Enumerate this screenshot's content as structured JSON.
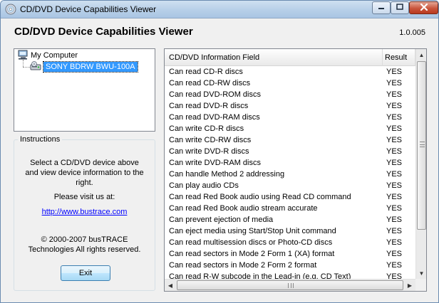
{
  "window": {
    "title": "CD/DVD Device Capabilities Viewer",
    "accent_color": "#b7cfe8",
    "close_color": "#c9553c"
  },
  "header": {
    "title": "CD/DVD Device Capabilities Viewer",
    "version": "1.0.005"
  },
  "tree": {
    "root_label": "My Computer",
    "root_icon": "computer-icon",
    "device_label": "SONY BDRW BWU-100A",
    "device_icon": "cd-drive-icon",
    "selection_color": "#3399ff"
  },
  "instructions": {
    "group_label": "Instructions",
    "text_1": "Select a CD/DVD device above and view device information to the right.",
    "text_2": "Please visit us at:",
    "link": "http://www.bustrace.com",
    "copyright": "© 2000-2007 busTRACE Technologies All rights reserved.",
    "exit_label": "Exit"
  },
  "list": {
    "columns": [
      "CD/DVD Information Field",
      "Result"
    ],
    "rows": [
      [
        "Can read CD-R discs",
        "YES"
      ],
      [
        "Can read CD-RW discs",
        "YES"
      ],
      [
        "Can read DVD-ROM discs",
        "YES"
      ],
      [
        "Can read DVD-R discs",
        "YES"
      ],
      [
        "Can read DVD-RAM discs",
        "YES"
      ],
      [
        "Can write CD-R discs",
        "YES"
      ],
      [
        "Can write CD-RW discs",
        "YES"
      ],
      [
        "Can write DVD-R discs",
        "YES"
      ],
      [
        "Can write DVD-RAM discs",
        "YES"
      ],
      [
        "Can handle Method 2 addressing",
        "YES"
      ],
      [
        "Can play audio CDs",
        "YES"
      ],
      [
        "Can read Red Book audio using Read CD command",
        "YES"
      ],
      [
        "Can read Red Book audio stream accurate",
        "YES"
      ],
      [
        "Can prevent ejection of media",
        "YES"
      ],
      [
        "Can eject media using Start/Stop Unit command",
        "YES"
      ],
      [
        "Can read multisession discs or Photo-CD discs",
        "YES"
      ],
      [
        "Can read sectors in Mode 2 Form 1 (XA) format",
        "YES"
      ],
      [
        "Can read sectors in Mode 2 Form 2 format",
        "YES"
      ],
      [
        "Can read R-W subcode in the Lead-in (e.g. CD Text)",
        "YES"
      ]
    ]
  }
}
